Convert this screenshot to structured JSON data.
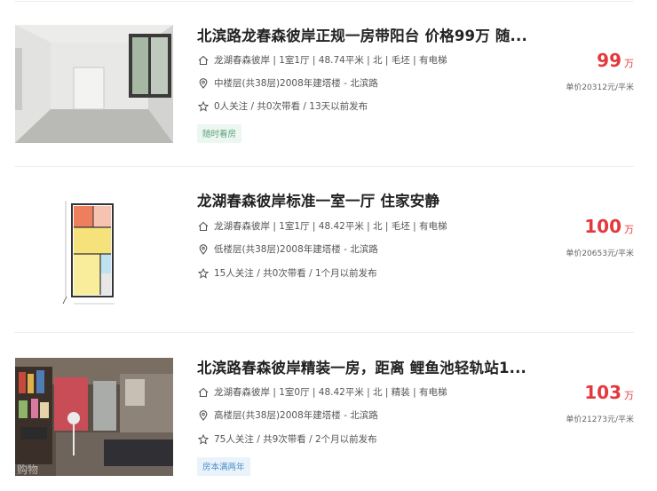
{
  "listings": [
    {
      "title": "北滨路龙春森彼岸正规一房带阳台 价格99万 随...",
      "house_info": "龙湖春森彼岸 | 1室1厅 | 48.74平米 | 北 | 毛坯 | 有电梯",
      "position_info": "中楼层(共38层)2008年建塔楼 - 北滨路",
      "follow_info": "0人关注 / 共0次带看 / 13天以前发布",
      "tag": "随时看房",
      "price": "99",
      "price_unit": "万",
      "unit_price": "单价20312元/平米",
      "image": "empty-room-photo"
    },
    {
      "title": "龙湖春森彼岸标准一室一厅 住家安静",
      "house_info": "龙湖春森彼岸 | 1室1厅 | 48.42平米 | 北 | 毛坯 | 有电梯",
      "position_info": "低楼层(共38层)2008年建塔楼 - 北滨路",
      "follow_info": "15人关注 / 共0次带看 / 1个月以前发布",
      "tag": "",
      "price": "100",
      "price_unit": "万",
      "unit_price": "单价20653元/平米",
      "image": "floor-plan"
    },
    {
      "title": "北滨路春森彼岸精装一房，距离 鲤鱼池轻轨站1...",
      "house_info": "龙湖春森彼岸 | 1室0厅 | 48.42平米 | 北 | 精装 | 有电梯",
      "position_info": "高楼层(共38层)2008年建塔楼 - 北滨路",
      "follow_info": "75人关注 / 共9次带看 / 2个月以前发布",
      "tag": "房本满两年",
      "price": "103",
      "price_unit": "万",
      "unit_price": "单价21273元/平米",
      "image": "furnished-living-room-photo"
    }
  ],
  "colors": {
    "price": "#e4393c",
    "tag_green": "#5aa079",
    "tag_blue": "#4e8fc8"
  },
  "icons": [
    "house-icon",
    "location-pin-icon",
    "star-icon"
  ]
}
